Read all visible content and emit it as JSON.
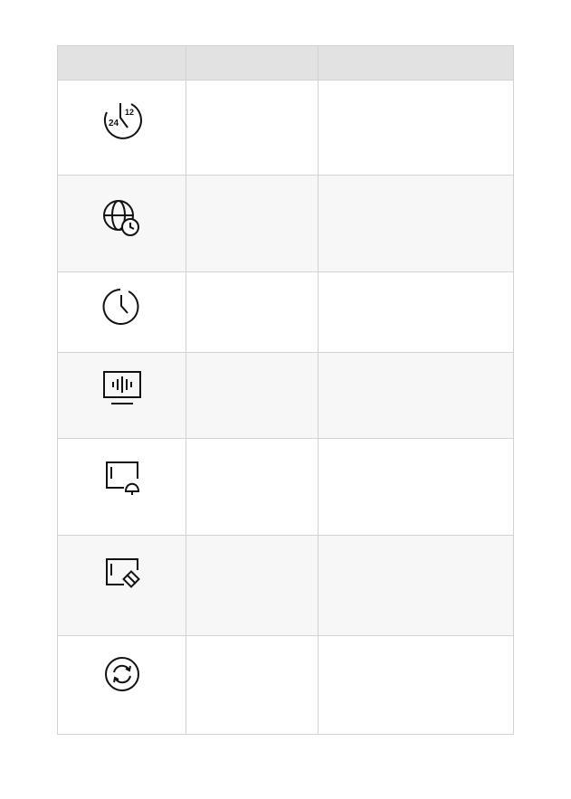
{
  "table": {
    "headers": [
      "",
      "",
      ""
    ],
    "rows": [
      {
        "icon": "24-12-hour-clock-icon",
        "name": "",
        "description": ""
      },
      {
        "icon": "globe-clock-icon",
        "name": "",
        "description": ""
      },
      {
        "icon": "clock-icon",
        "name": "",
        "description": ""
      },
      {
        "icon": "screen-audio-icon",
        "name": "",
        "description": ""
      },
      {
        "icon": "card-bell-icon",
        "name": "",
        "description": ""
      },
      {
        "icon": "card-eraser-icon",
        "name": "",
        "description": ""
      },
      {
        "icon": "sync-icon",
        "name": "",
        "description": ""
      }
    ],
    "icon_labels": {
      "hour24": "24",
      "hour12": "12"
    }
  }
}
